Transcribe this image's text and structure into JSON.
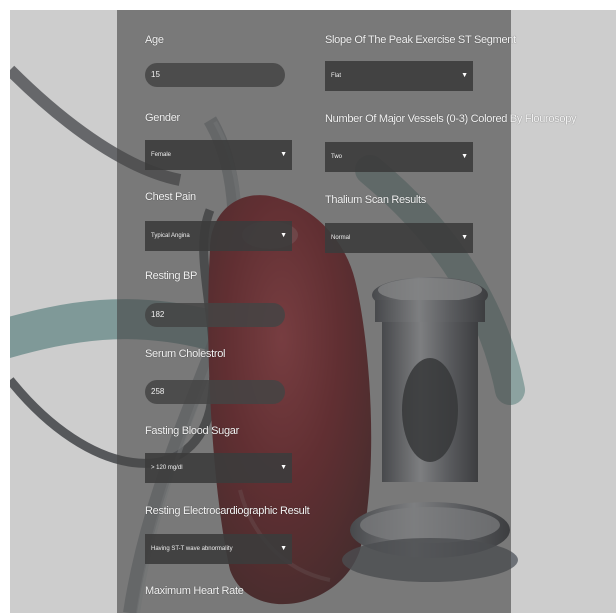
{
  "form": {
    "age": {
      "label": "Age",
      "value": "15"
    },
    "gender": {
      "label": "Gender",
      "value": "Female"
    },
    "chest_pain": {
      "label": "Chest Pain",
      "value": "Typical Angina"
    },
    "resting_bp": {
      "label": "Resting BP",
      "value": "182"
    },
    "serum_cholestrol": {
      "label": "Serum Cholestrol",
      "value": "258"
    },
    "fasting_blood_sugar": {
      "label": "Fasting Blood Sugar",
      "value": "> 120 mg/dl"
    },
    "resting_ecg": {
      "label": "Resting Electrocardiographic Result",
      "value": "Having ST-T wave abnormality"
    },
    "max_heart_rate": {
      "label": "Maximum Heart Rate"
    },
    "slope": {
      "label": "Slope Of The Peak Exercise ST Segment",
      "value": "Flat"
    },
    "major_vessels": {
      "label": "Number Of Major Vessels (0-3) Colored By Flourosopy",
      "value": "Two"
    },
    "thalium": {
      "label": "Thalium Scan Results",
      "value": "Normal"
    }
  },
  "icons": {
    "dropdown": "caret-down-icon"
  },
  "colors": {
    "heart": "#8e0c14",
    "panel": "#464646",
    "page_background": "#c4c4c4"
  }
}
